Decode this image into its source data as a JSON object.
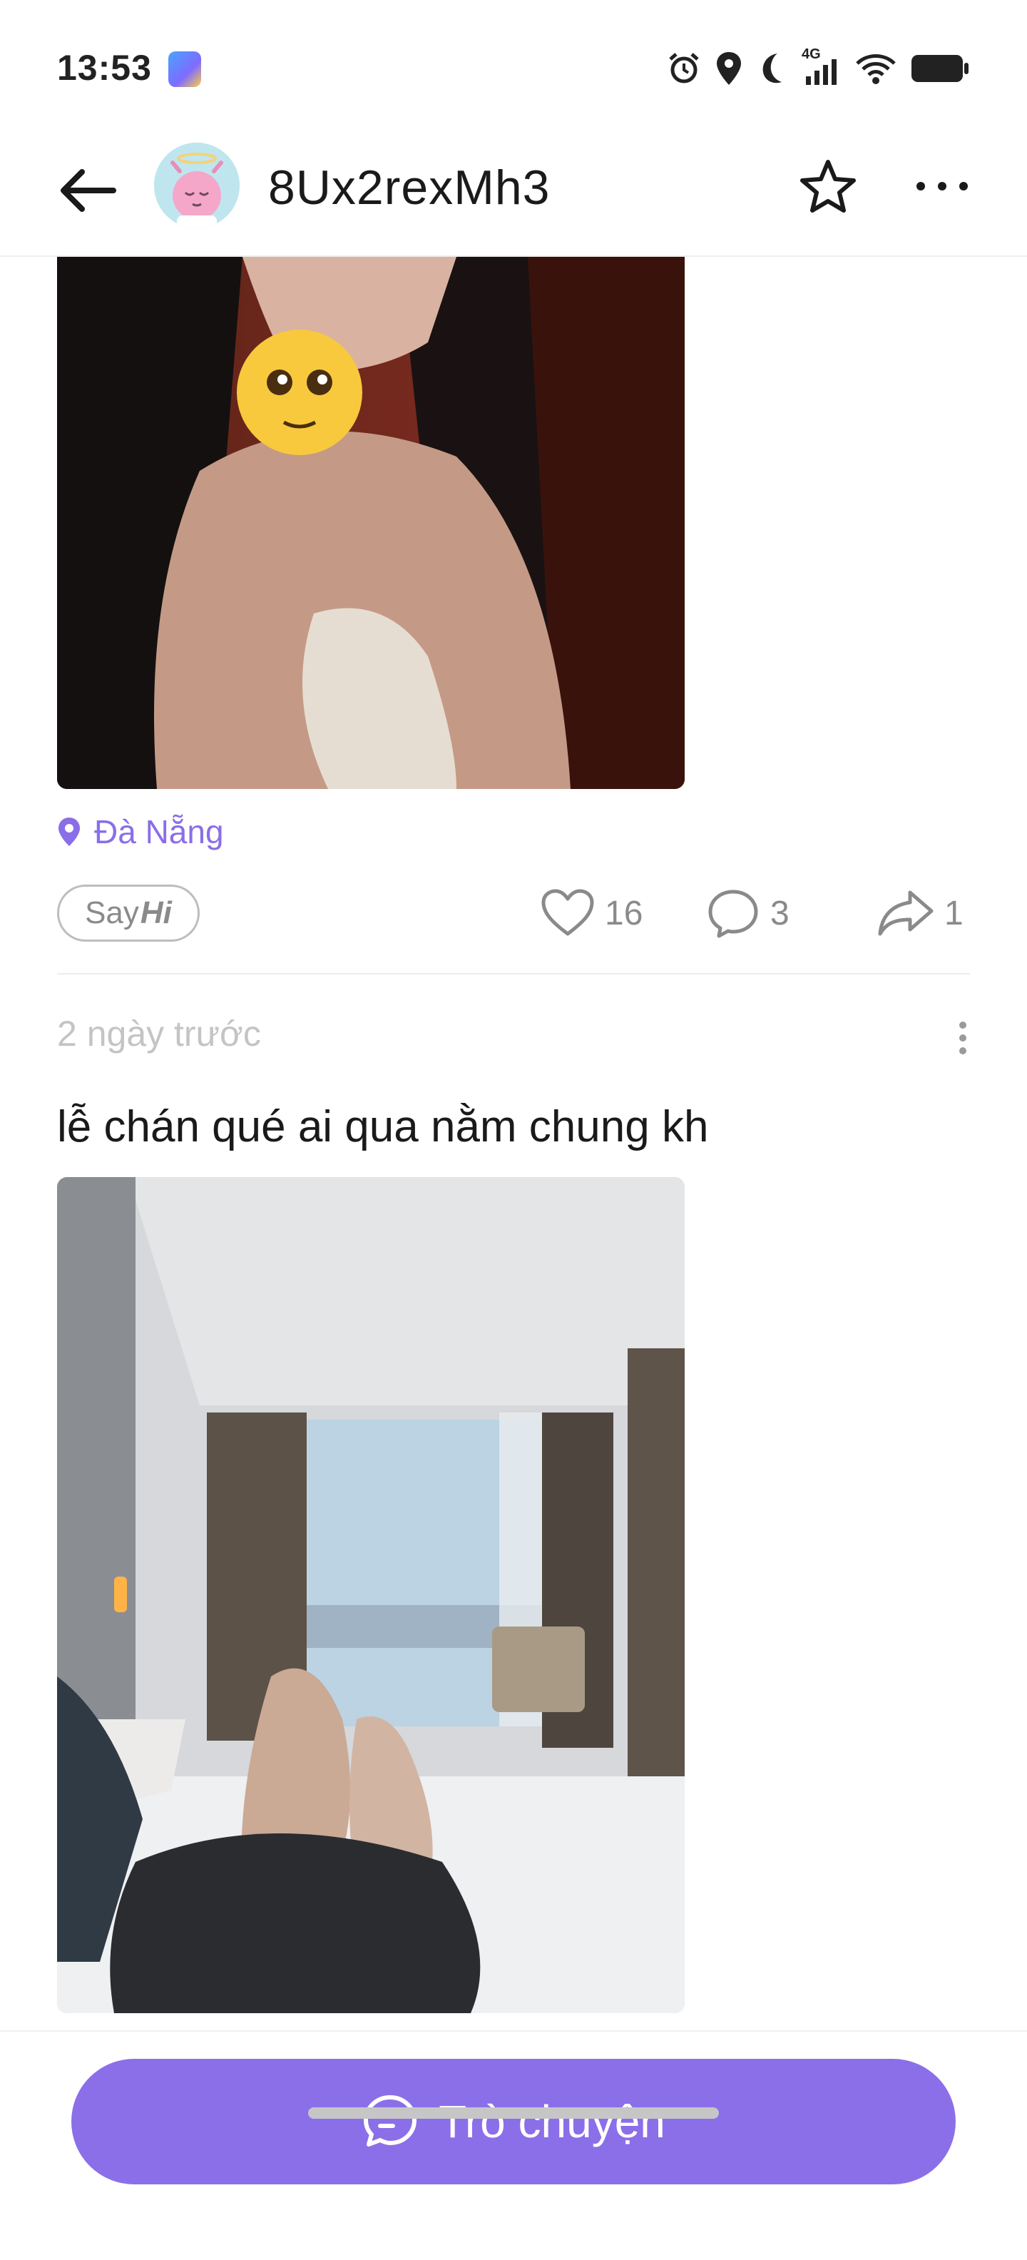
{
  "status_bar": {
    "time": "13:53",
    "network": "4G",
    "icons": [
      "alarm-icon",
      "location-icon",
      "moon-icon",
      "signal-icon",
      "wifi-icon",
      "battery-icon"
    ]
  },
  "header": {
    "username": "8Ux2rexMh3",
    "icons": [
      "back-arrow-icon",
      "star-icon",
      "more-horizontal-icon"
    ]
  },
  "post1": {
    "location": "Đà Nẵng",
    "say_hi": {
      "say": "Say",
      "hi": "Hi"
    },
    "likes": "16",
    "comments": "3",
    "shares": "1"
  },
  "post2": {
    "time_ago": "2 ngày trước",
    "text": "lễ chán qué ai qua nằm chung kh"
  },
  "bottom": {
    "chat_label": "Trò chuyện"
  },
  "colors": {
    "accent": "#8b6fe8",
    "location": "#8a6ee8",
    "muted": "#8a8a8a"
  }
}
